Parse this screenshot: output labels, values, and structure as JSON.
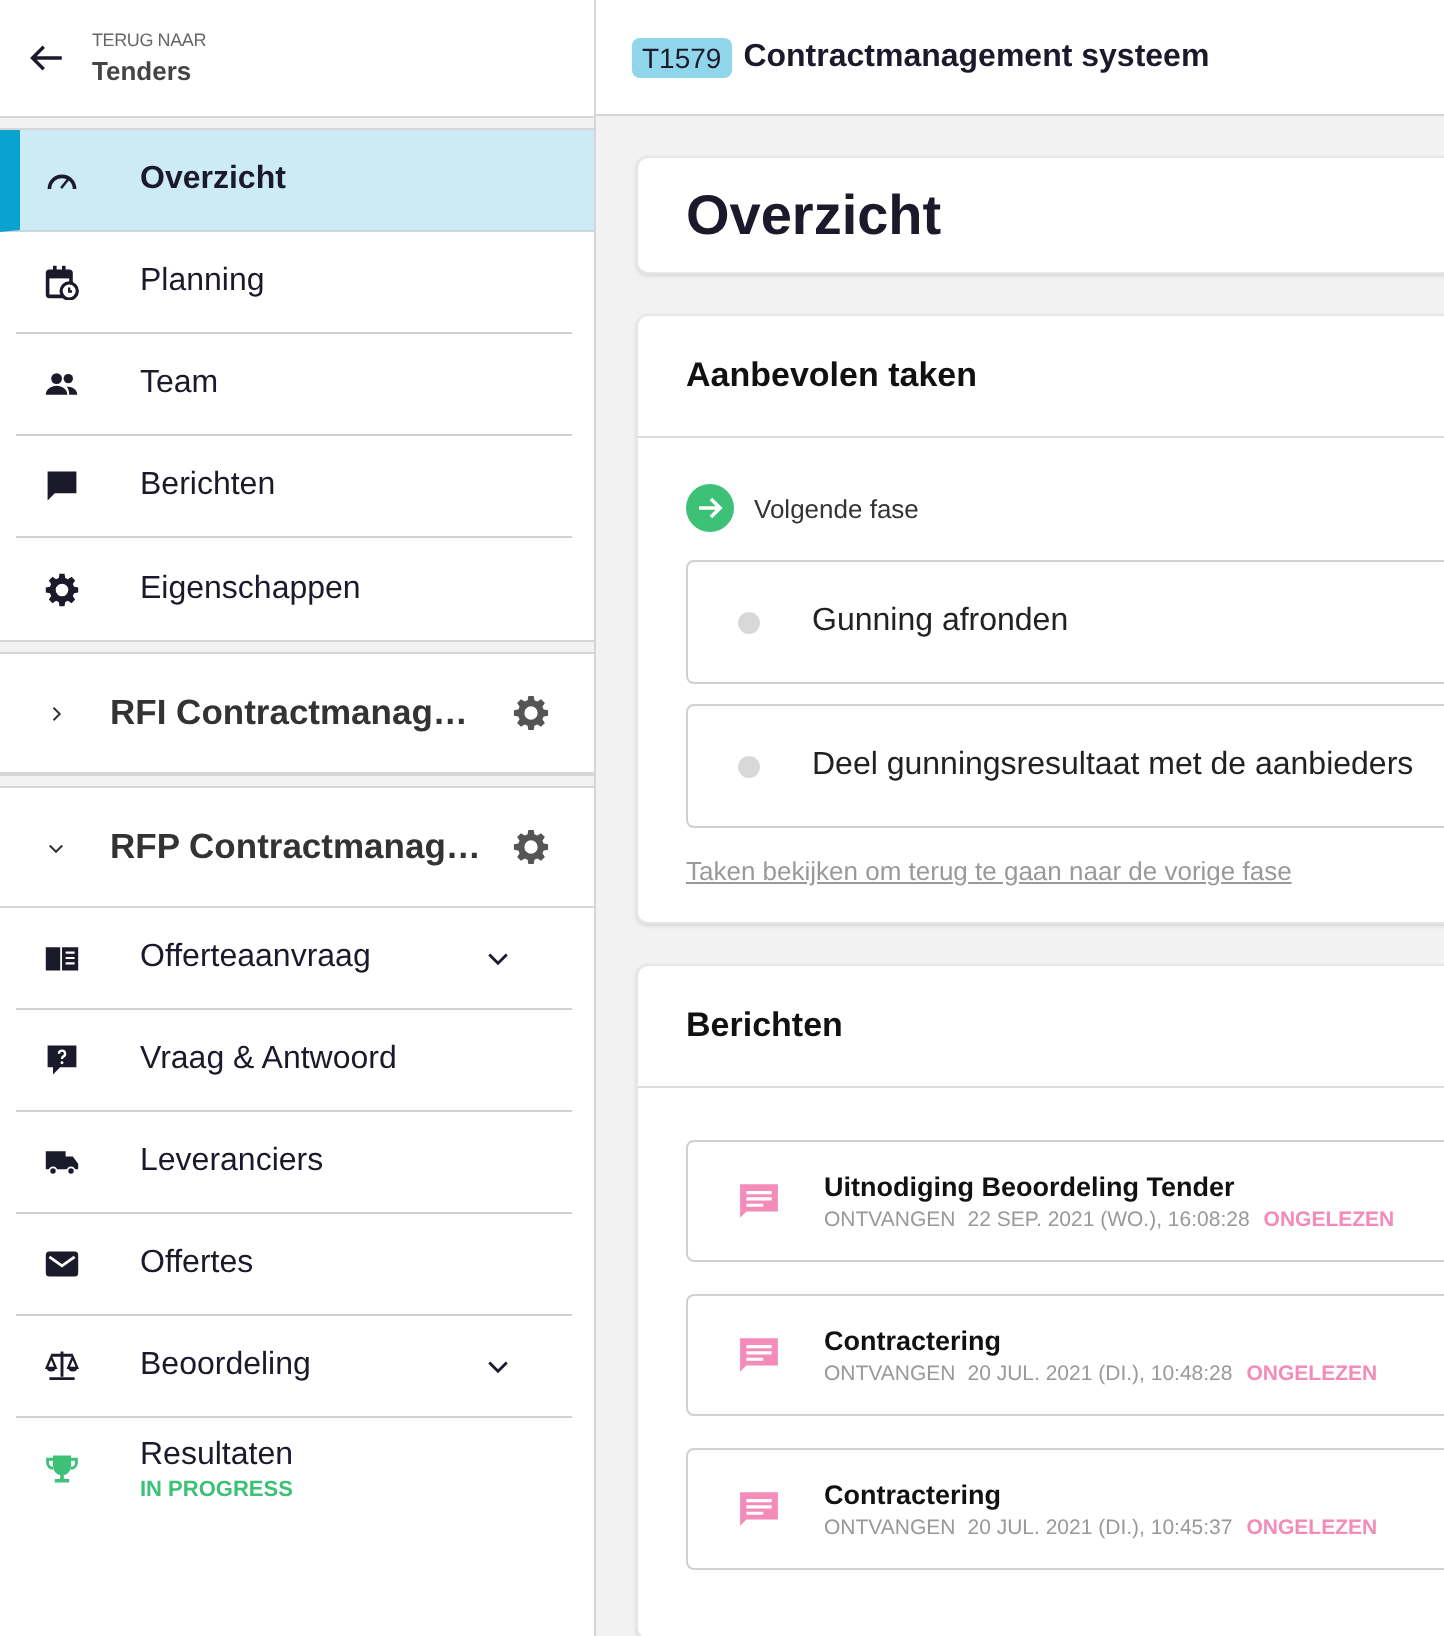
{
  "sidebar": {
    "back": {
      "label": "TERUG NAAR",
      "title": "Tenders"
    },
    "nav": [
      {
        "label": "Overzicht",
        "selected": true
      },
      {
        "label": "Planning",
        "selected": false
      },
      {
        "label": "Team",
        "selected": false
      },
      {
        "label": "Berichten",
        "selected": false
      },
      {
        "label": "Eigenschappen",
        "selected": false
      }
    ],
    "projects": [
      {
        "title": "RFI Contractmanag…",
        "expanded": false
      },
      {
        "title": "RFP Contractmanag…",
        "expanded": true,
        "items": [
          {
            "label": "Offerteaanvraag",
            "has_submenu": true
          },
          {
            "label": "Vraag & Antwoord",
            "has_submenu": false
          },
          {
            "label": "Leveranciers",
            "has_submenu": false
          },
          {
            "label": "Offertes",
            "has_submenu": false
          },
          {
            "label": "Beoordeling",
            "has_submenu": true
          },
          {
            "label": "Resultaten",
            "has_submenu": false,
            "status": "IN PROGRESS"
          }
        ]
      }
    ]
  },
  "header": {
    "badge": "T1579",
    "title": "Contractmanagement systeem"
  },
  "page_title": "Overzicht",
  "tasks_card": {
    "title": "Aanbevolen taken",
    "phase": "Volgende fase",
    "tasks": [
      {
        "label": "Gunning afronden",
        "done": false
      },
      {
        "label": "Deel gunningsresultaat met de aanbieders",
        "done": false
      }
    ],
    "link": "Taken bekijken om terug te gaan naar de vorige fase"
  },
  "messages_card": {
    "title": "Berichten",
    "messages": [
      {
        "subject": "Uitnodiging Beoordeling Tender",
        "received": "ONTVANGEN",
        "date": "22 SEP. 2021 (WO.), 16:08:28",
        "status": "ONGELEZEN"
      },
      {
        "subject": "Contractering",
        "received": "ONTVANGEN",
        "date": "20 JUL. 2021 (DI.), 10:48:28",
        "status": "ONGELEZEN"
      },
      {
        "subject": "Contractering",
        "received": "ONTVANGEN",
        "date": "20 JUL. 2021 (DI.), 10:45:37",
        "status": "ONGELEZEN"
      }
    ]
  }
}
